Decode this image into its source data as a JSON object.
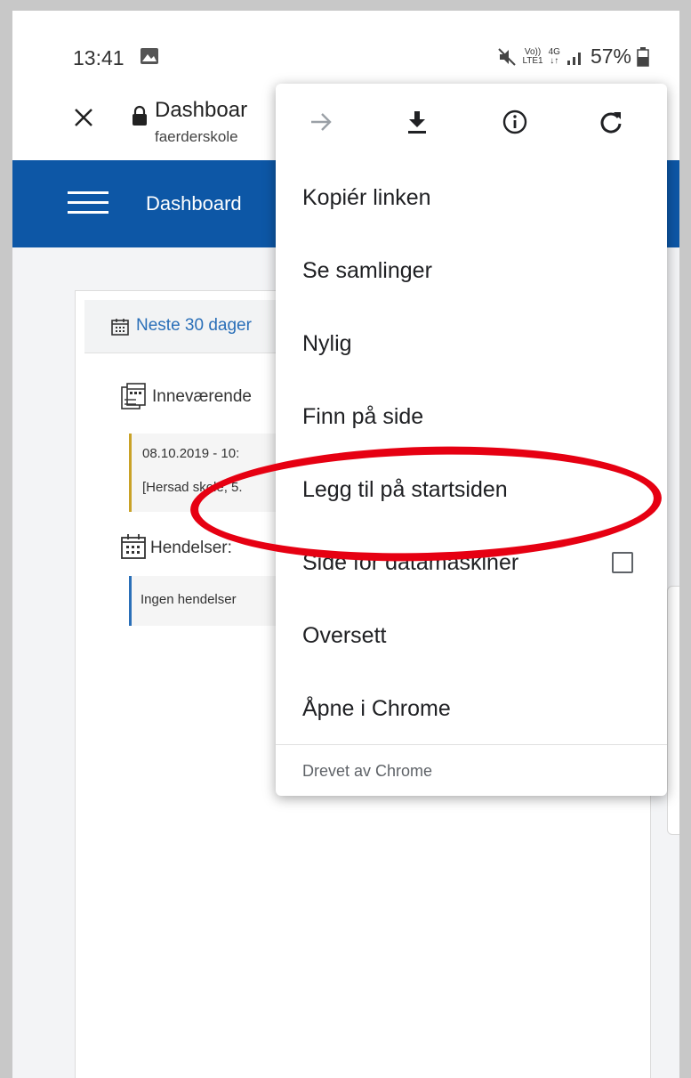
{
  "status_bar": {
    "time": "13:41",
    "network_top": "Vo))",
    "network_bottom": "LTE1",
    "network_type": "4G",
    "battery": "57%"
  },
  "toolbar": {
    "title": "Dashboar",
    "url": "faerderskole"
  },
  "app_header": {
    "title": "Dashboard"
  },
  "content": {
    "next30": "Neste 30 dager",
    "current_label": "Inneværende",
    "current_line1": "08.10.2019 - 10:",
    "current_line2": "[Hersad skole, 5.",
    "events_label": "Hendelser:",
    "events_text": "Ingen hendelser"
  },
  "menu": {
    "icons": [
      "forward-icon",
      "download-icon",
      "info-icon",
      "reload-icon"
    ],
    "items": [
      {
        "label": "Kopiér linken"
      },
      {
        "label": "Se samlinger"
      },
      {
        "label": "Nylig"
      },
      {
        "label": "Finn på side"
      },
      {
        "label": "Legg til på startsiden"
      },
      {
        "label": "Side for datamaskiner",
        "checked": false
      },
      {
        "label": "Oversett"
      },
      {
        "label": "Åpne i Chrome"
      }
    ],
    "footer": "Drevet av Chrome"
  },
  "annotation": {
    "color": "#e60012"
  },
  "colors": {
    "header_blue": "#0d57a6",
    "link_blue": "#2a6fb8",
    "accent_gold": "#c9a227"
  }
}
